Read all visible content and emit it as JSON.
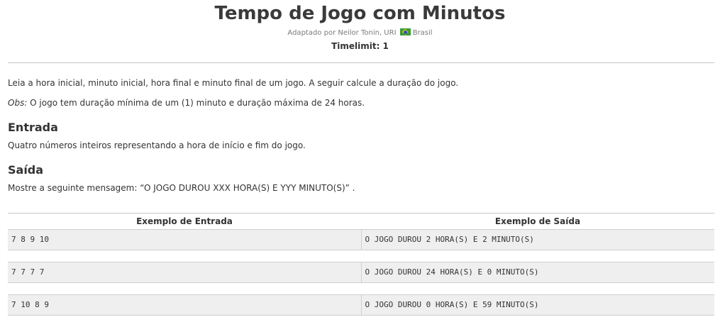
{
  "problem": {
    "title": "Tempo de Jogo com Minutos",
    "author_prefix": "Adaptado por Neilor Tonin, URI",
    "country": "Brasil",
    "timelimit": "Timelimit: 1"
  },
  "description": {
    "statement": "Leia a hora inicial, minuto inicial, hora final e minuto final de um jogo. A seguir calcule a duração do jogo.",
    "obs_label": "Obs:",
    "obs_text": " O jogo tem duração mínima de um (1) minuto e duração máxima de 24 horas."
  },
  "input_section": {
    "heading": "Entrada",
    "text": "Quatro números inteiros representando a hora de início e fim do jogo."
  },
  "output_section": {
    "heading": "Saída",
    "text": "Mostre a seguinte mensagem: “O JOGO DUROU XXX HORA(S) E YYY MINUTO(S)” ."
  },
  "examples": {
    "input_header": "Exemplo de Entrada",
    "output_header": "Exemplo de Saída",
    "rows": [
      {
        "input": "7 8 9 10",
        "output": "O JOGO DUROU 2 HORA(S) E 2 MINUTO(S)"
      },
      {
        "input": "7 7 7 7",
        "output": "O JOGO DUROU 24 HORA(S) E 0 MINUTO(S)"
      },
      {
        "input": "7 10 8 9",
        "output": "O JOGO DUROU 0 HORA(S) E 59 MINUTO(S)"
      }
    ]
  },
  "colors": {
    "flag_green": "#3a9a3a",
    "flag_yellow": "#f2d21c",
    "flag_blue": "#2b4ea0",
    "row_bg": "#efefef"
  }
}
